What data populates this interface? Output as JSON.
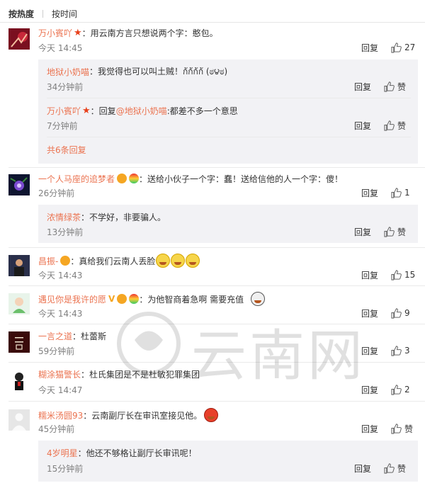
{
  "tabs": {
    "hot": "按热度",
    "time": "按时间"
  },
  "actions": {
    "reply": "回复",
    "like_text": "赞"
  },
  "watermark": {
    "text": "云南网"
  },
  "comments": [
    {
      "name": "万小賓吖",
      "text": "：用云南方言只想说两个字：憨包。",
      "time": "今天 14:45",
      "likes": "27",
      "replies": [
        {
          "name": "地狱小奶喵",
          "text": "：我觉得也可以叫土贼！ก้ก้ก้ก้ (ಠ౪ಠ)",
          "time": "34分钟前"
        },
        {
          "name": "万小賓吖",
          "prefix": "：回复",
          "at": "@地狱小奶喵",
          "text": ":都差不多一个意思",
          "time": "7分钟前"
        }
      ],
      "more": "共6条回复"
    },
    {
      "name": "一个人马座的追梦者",
      "text": "：送给小伙子一个字：蠢！送给信他的人一个字：傻！",
      "time": "26分钟前",
      "likes": "1",
      "replies": [
        {
          "name": "浓情绿茶",
          "text": "：不学好，非要骗人。",
          "time": "13分钟前"
        }
      ]
    },
    {
      "name": "昌振-",
      "text": "：真给我们云南人丢脸",
      "time": "今天 14:43",
      "likes": "15"
    },
    {
      "name": "遇见你是我许的愿",
      "text": "：为他智商着急啊 需要充值",
      "time": "今天 14:43",
      "likes": "9"
    },
    {
      "name": "一言之道",
      "text": "：杜蕾斯",
      "time": "59分钟前",
      "likes": "3"
    },
    {
      "name": "糊涂猫警长",
      "text": "：杜氏集团是不是杜敏犯罪集团",
      "time": "今天 14:47",
      "likes": "2"
    },
    {
      "name": "糯米汤圆93",
      "text": "：云南副厅长在审讯室接见他。",
      "time": "45分钟前",
      "likes": "",
      "replies": [
        {
          "name": "4岁明星",
          "text": "：他还不够格让副厅长审讯呢！",
          "time": "15分钟前"
        }
      ]
    }
  ],
  "colors": {
    "name": "#eb7350",
    "reply_bg": "#f2f2f5",
    "time": "#808080"
  }
}
